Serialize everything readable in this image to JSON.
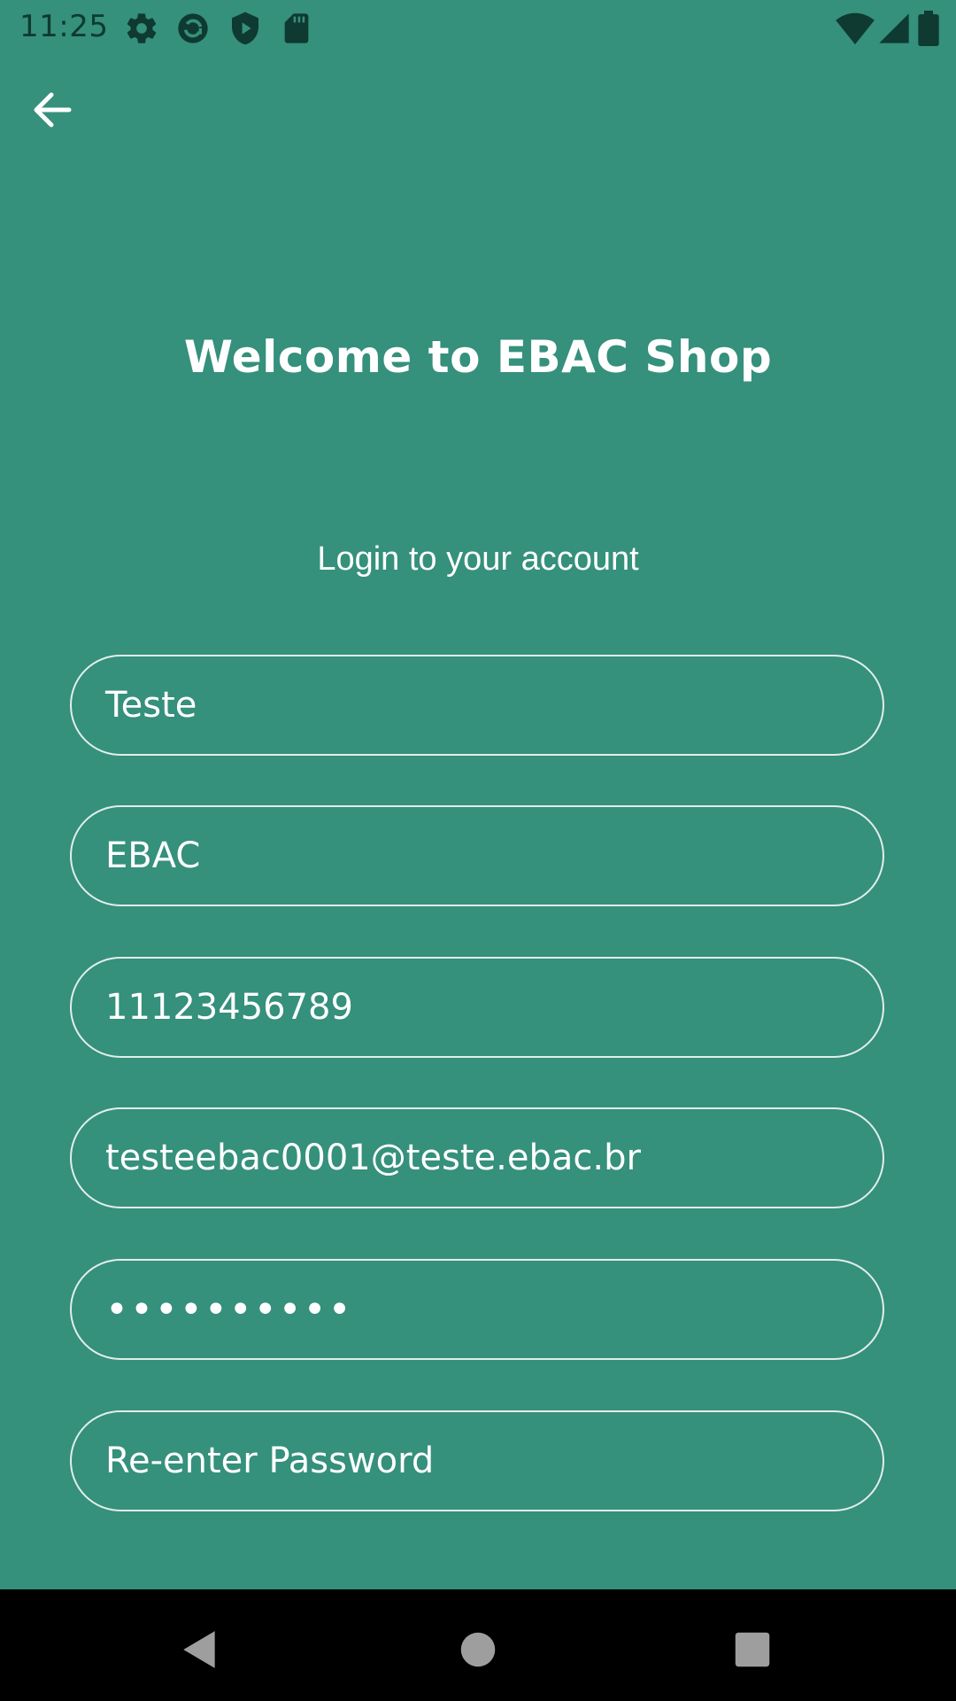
{
  "status_bar": {
    "time": "11:25",
    "icons_left": [
      "gear-icon",
      "sync-icon",
      "shield-icon",
      "sd-card-icon"
    ],
    "icons_right": [
      "wifi-icon",
      "signal-icon",
      "battery-icon"
    ]
  },
  "header": {
    "back_icon": "arrow-left-icon"
  },
  "main": {
    "title": "Welcome to EBAC Shop",
    "subtitle": "Login to your account",
    "fields": {
      "first_name": "Teste",
      "last_name": "EBAC",
      "phone": "11123456789",
      "email": "testeebac0001@teste.ebac.br",
      "password": "••••••••••",
      "confirm_password_placeholder": "Re-enter Password"
    }
  },
  "colors": {
    "background": "#35907c",
    "text": "#ffffff",
    "status_icons": "#0f3a31",
    "nav_bar": "#000000"
  },
  "nav_bar": {
    "icons": [
      "back-triangle-icon",
      "home-circle-icon",
      "recents-square-icon"
    ]
  }
}
